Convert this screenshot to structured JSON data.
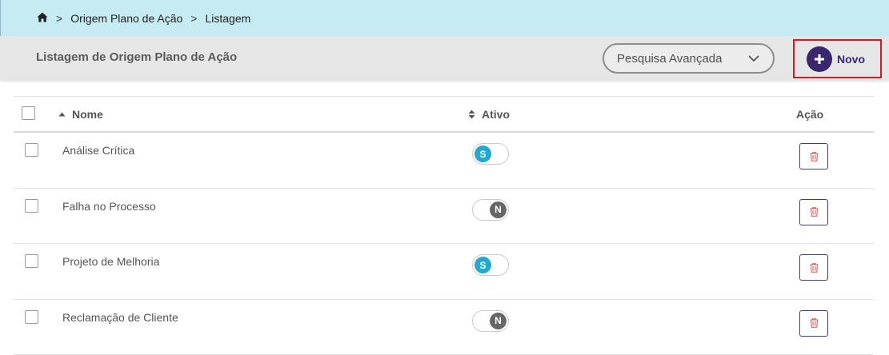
{
  "breadcrumb": {
    "home_icon": "home-icon",
    "separator": ">",
    "items": [
      "Origem Plano de Ação",
      "Listagem"
    ]
  },
  "header": {
    "title": "Listagem de Origem Plano de Ação",
    "advanced_search_label": "Pesquisa Avançada",
    "new_button_label": "Novo"
  },
  "table": {
    "columns": {
      "name": "Nome",
      "active": "Ativo",
      "action": "Ação"
    },
    "rows": [
      {
        "name": "Análise Crítica",
        "active": true,
        "active_label": "S"
      },
      {
        "name": "Falha no Processo",
        "active": false,
        "active_label": "N"
      },
      {
        "name": "Projeto de Melhoria",
        "active": true,
        "active_label": "S"
      },
      {
        "name": "Reclamação de Cliente",
        "active": false,
        "active_label": "N"
      }
    ]
  },
  "colors": {
    "breadcrumb_bg": "#c6ebf3",
    "header_bg": "#e6e6e6",
    "primary": "#3b2770",
    "toggle_on": "#22a9d3",
    "toggle_off": "#666666",
    "delete_icon": "#d9534f",
    "highlight_border": "#e0161e"
  }
}
